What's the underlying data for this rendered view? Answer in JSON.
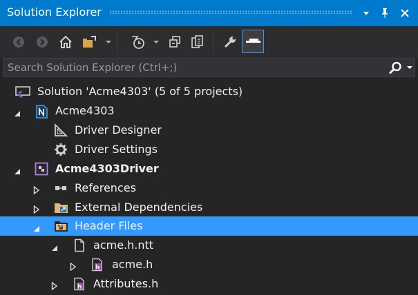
{
  "window": {
    "title": "Solution Explorer",
    "accent": "#007acc"
  },
  "title_buttons": [
    {
      "name": "window-position-icon",
      "glyph": "▾"
    },
    {
      "name": "pin-icon",
      "glyph": "⊥"
    },
    {
      "name": "close-icon",
      "glyph": "✕"
    }
  ],
  "toolbar": {
    "buttons": [
      "back-icon",
      "forward-icon",
      "home-icon",
      "switch-views-icon",
      "pending-changes-filter-icon",
      "collapse-all-icon",
      "show-all-files-icon",
      "properties-icon",
      "preview-selected-items-icon"
    ]
  },
  "search": {
    "placeholder": "Search Solution Explorer (Ctrl+;)",
    "value": ""
  },
  "tree": {
    "selection_color": "#3399ff",
    "items": [
      {
        "label": "Solution 'Acme4303' (5 of 5 projects)",
        "icon": "solution-icon",
        "expander": "none",
        "bold": false,
        "selected": false
      },
      {
        "label": "Acme4303",
        "icon": "package-project-icon",
        "expander": "expanded",
        "bold": false,
        "selected": false
      },
      {
        "label": "Driver Designer",
        "icon": "driver-designer-icon",
        "expander": "none",
        "bold": false,
        "selected": false
      },
      {
        "label": "Driver Settings",
        "icon": "gear-icon",
        "expander": "none",
        "bold": false,
        "selected": false
      },
      {
        "label": "Acme4303Driver",
        "icon": "cpp-project-icon",
        "expander": "expanded",
        "bold": true,
        "selected": false
      },
      {
        "label": "References",
        "icon": "references-icon",
        "expander": "collapsed",
        "bold": false,
        "selected": false
      },
      {
        "label": "External Dependencies",
        "icon": "external-dependencies-icon",
        "expander": "collapsed",
        "bold": false,
        "selected": false
      },
      {
        "label": "Header Files",
        "icon": "filter-folder-icon",
        "expander": "expanded",
        "bold": false,
        "selected": true
      },
      {
        "label": "acme.h.ntt",
        "icon": "file-icon",
        "expander": "expanded",
        "bold": false,
        "selected": false
      },
      {
        "label": "acme.h",
        "icon": "header-file-icon",
        "expander": "collapsed",
        "bold": false,
        "selected": false
      },
      {
        "label": "Attributes.h",
        "icon": "header-file-icon",
        "expander": "collapsed",
        "bold": false,
        "selected": false
      }
    ]
  }
}
